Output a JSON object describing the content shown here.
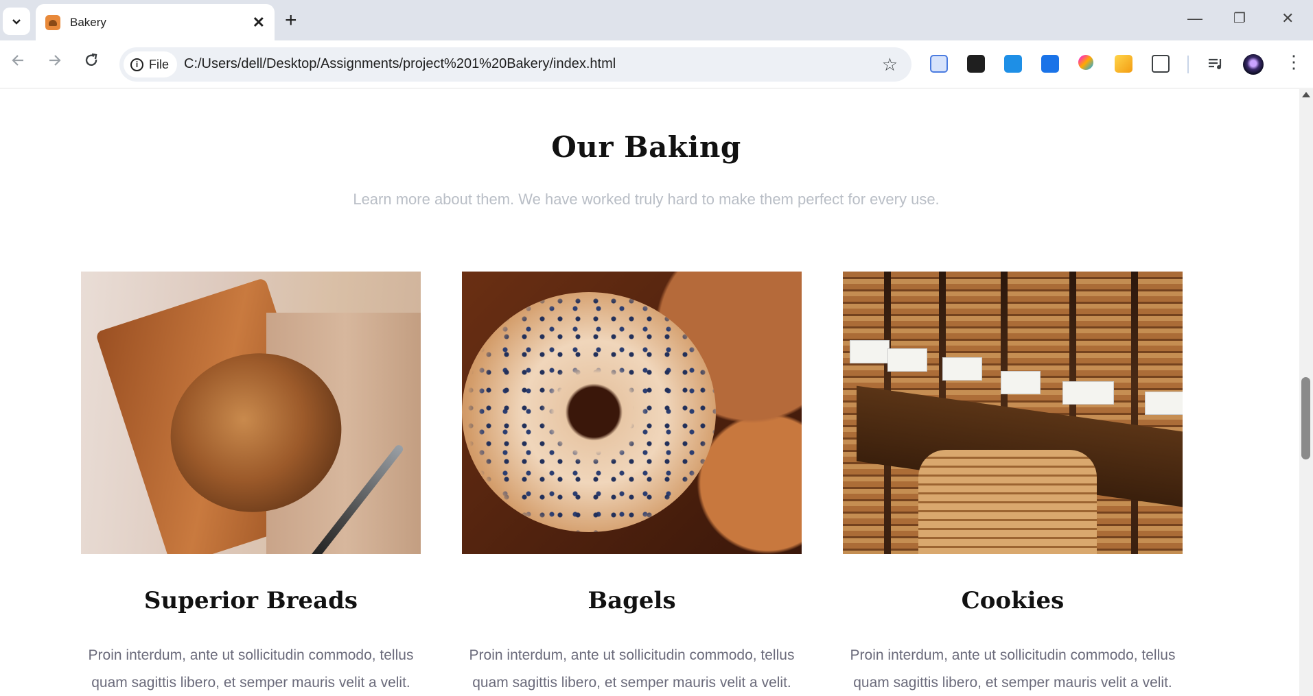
{
  "browser": {
    "tab_title": "Bakery",
    "tab_close": "✕",
    "new_tab": "+",
    "file_chip": "File",
    "url": "C:/Users/dell/Desktop/Assignments/project%201%20Bakery/index.html",
    "window_controls": {
      "minimize": "—",
      "restore": "❐",
      "close": "✕"
    }
  },
  "section": {
    "title": "Our Baking",
    "subtitle": "Learn more about them. We have worked truly hard to make them perfect for every use."
  },
  "cards": [
    {
      "title": "Superior Breads",
      "text": "Proin interdum, ante ut sollicitudin commodo, tellus quam sagittis libero, et semper mauris velit a velit."
    },
    {
      "title": "Bagels",
      "text": "Proin interdum, ante ut sollicitudin commodo, tellus quam sagittis libero, et semper mauris velit a velit."
    },
    {
      "title": "Cookies",
      "text": "Proin interdum, ante ut sollicitudin commodo, tellus quam sagittis libero, et semper mauris velit a velit."
    }
  ]
}
